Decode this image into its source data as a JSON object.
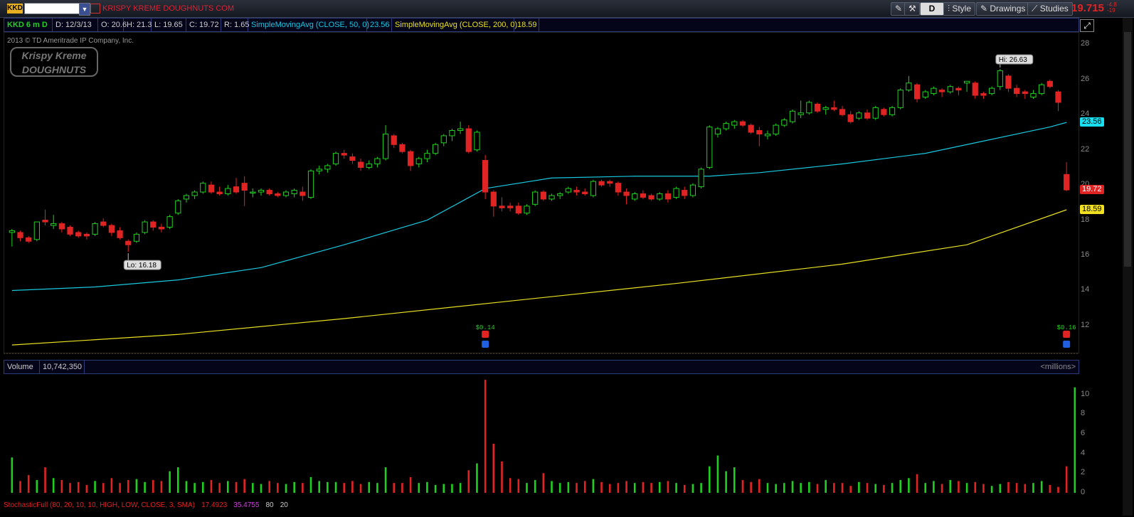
{
  "toolbar": {
    "symbol_badge": "KKD",
    "company_name": "KRISPY KREME DOUGHNUTS COM",
    "period_button": "D",
    "style_label": "Style",
    "drawings_label": "Drawings",
    "studies_label": "Studies",
    "last_price": "19.715",
    "change_top": "-4.8",
    "change_bottom": "-19"
  },
  "studybar": {
    "ticker_period": "KKD 6 m D",
    "date": "D: 12/3/13",
    "open": "O: 20.6",
    "high": "H: 21.3",
    "low": "L: 19.65",
    "close": "C: 19.72",
    "range": "R: 1.65",
    "sma50_label": "SimpleMovingAvg (CLOSE, 50, 0)",
    "sma50_value": "23.56",
    "sma200_label": "SimpleMovingAvg (CLOSE, 200, 0)",
    "sma200_value": "18.59"
  },
  "copyright": "2013 © TD Ameritrade IP Company, Inc.",
  "logo_text": "Krispy Kreme DOUGHNUTS",
  "price_panel": {
    "hi_label": "Hi: 26.63",
    "lo_label": "Lo: 16.18",
    "dividend_1": "$0.14",
    "dividend_2": "$0.16",
    "axis_ticks": [
      "28",
      "26",
      "24",
      "22",
      "20",
      "18",
      "16",
      "14",
      "12"
    ],
    "tag_sma50": "23.56",
    "tag_close": "19.72",
    "tag_sma200": "18.59"
  },
  "volume_panel": {
    "label": "Volume",
    "value": "10,742,350",
    "unit": "<millions>",
    "axis_ticks": [
      "10",
      "8",
      "6",
      "4",
      "2",
      "0"
    ]
  },
  "stoch_panel": {
    "label": "StochasticFull (80, 20, 10, 10, HIGH, LOW, CLOSE, 3, SMA)",
    "k": "17.4923",
    "d": "35.4755",
    "ob": "80",
    "os": "20"
  },
  "chart_data": {
    "type": "candlestick",
    "title": "KKD 6 m D",
    "ylim": [
      10.5,
      28.5
    ],
    "candles": [
      [
        17.3,
        17.5,
        16.5,
        17.4
      ],
      [
        17.3,
        17.4,
        16.8,
        17.0
      ],
      [
        17.0,
        17.1,
        16.7,
        16.8
      ],
      [
        16.9,
        17.9,
        16.8,
        17.9
      ],
      [
        18.0,
        18.6,
        17.7,
        17.9
      ],
      [
        17.7,
        18.3,
        17.5,
        17.8
      ],
      [
        17.8,
        17.9,
        17.3,
        17.5
      ],
      [
        17.6,
        17.7,
        17.1,
        17.2
      ],
      [
        17.3,
        17.4,
        17.0,
        17.1
      ],
      [
        17.2,
        17.3,
        16.9,
        17.1
      ],
      [
        17.2,
        17.9,
        17.1,
        17.8
      ],
      [
        17.9,
        18.1,
        17.6,
        17.7
      ],
      [
        17.7,
        17.8,
        17.1,
        17.3
      ],
      [
        17.4,
        17.6,
        16.9,
        17.0
      ],
      [
        16.8,
        16.9,
        16.2,
        16.6
      ],
      [
        16.8,
        17.3,
        16.7,
        17.2
      ],
      [
        17.3,
        18.0,
        17.2,
        17.9
      ],
      [
        17.9,
        18.0,
        17.4,
        17.6
      ],
      [
        17.6,
        17.8,
        17.3,
        17.5
      ],
      [
        17.6,
        18.3,
        17.5,
        18.2
      ],
      [
        18.4,
        19.2,
        18.3,
        19.1
      ],
      [
        19.2,
        19.5,
        19.0,
        19.4
      ],
      [
        19.4,
        19.7,
        19.2,
        19.6
      ],
      [
        19.6,
        20.2,
        19.5,
        20.1
      ],
      [
        20.0,
        20.2,
        19.5,
        19.6
      ],
      [
        19.6,
        19.9,
        19.4,
        19.5
      ],
      [
        19.5,
        20.0,
        19.4,
        19.8
      ],
      [
        19.9,
        20.4,
        19.5,
        19.6
      ],
      [
        20.1,
        20.5,
        18.8,
        19.7
      ],
      [
        19.6,
        19.8,
        19.3,
        19.6
      ],
      [
        19.6,
        19.8,
        19.4,
        19.7
      ],
      [
        19.7,
        19.8,
        19.4,
        19.5
      ],
      [
        19.5,
        19.6,
        19.3,
        19.4
      ],
      [
        19.4,
        19.7,
        19.3,
        19.6
      ],
      [
        19.5,
        19.8,
        19.3,
        19.7
      ],
      [
        19.6,
        19.9,
        19.1,
        19.4
      ],
      [
        19.3,
        20.9,
        19.2,
        20.8
      ],
      [
        20.8,
        21.1,
        20.6,
        20.9
      ],
      [
        20.9,
        21.2,
        20.7,
        21.1
      ],
      [
        21.2,
        21.9,
        21.1,
        21.8
      ],
      [
        21.8,
        22.0,
        21.5,
        21.7
      ],
      [
        21.6,
        21.8,
        21.2,
        21.4
      ],
      [
        21.3,
        21.5,
        20.8,
        21.0
      ],
      [
        21.0,
        21.4,
        20.9,
        21.2
      ],
      [
        21.2,
        21.6,
        21.0,
        21.5
      ],
      [
        21.5,
        23.4,
        21.4,
        22.9
      ],
      [
        22.8,
        22.9,
        22.1,
        22.3
      ],
      [
        22.3,
        22.4,
        21.8,
        21.9
      ],
      [
        21.9,
        22.0,
        20.8,
        21.1
      ],
      [
        21.2,
        21.6,
        21.0,
        21.5
      ],
      [
        21.5,
        22.0,
        21.3,
        21.8
      ],
      [
        21.8,
        22.4,
        21.7,
        22.3
      ],
      [
        22.4,
        22.9,
        22.2,
        22.8
      ],
      [
        22.8,
        23.2,
        22.5,
        23.1
      ],
      [
        23.1,
        23.6,
        22.9,
        23.2
      ],
      [
        23.2,
        23.4,
        21.8,
        21.9
      ],
      [
        22.0,
        23.1,
        21.9,
        23.0
      ],
      [
        21.4,
        21.7,
        19.2,
        19.6
      ],
      [
        19.6,
        19.7,
        18.2,
        18.8
      ],
      [
        18.8,
        19.3,
        18.5,
        18.7
      ],
      [
        18.8,
        19.0,
        18.5,
        18.7
      ],
      [
        18.8,
        19.0,
        18.3,
        18.4
      ],
      [
        18.4,
        18.9,
        18.3,
        18.8
      ],
      [
        18.9,
        19.7,
        18.8,
        19.6
      ],
      [
        19.6,
        19.7,
        19.1,
        19.2
      ],
      [
        19.2,
        19.5,
        19.1,
        19.4
      ],
      [
        19.4,
        19.6,
        19.2,
        19.5
      ],
      [
        19.6,
        19.9,
        19.5,
        19.8
      ],
      [
        19.7,
        19.9,
        19.4,
        19.6
      ],
      [
        19.6,
        19.8,
        19.4,
        19.5
      ],
      [
        19.4,
        20.3,
        19.3,
        20.2
      ],
      [
        20.2,
        20.3,
        19.9,
        20.0
      ],
      [
        20.2,
        20.3,
        19.9,
        20.1
      ],
      [
        20.1,
        20.2,
        19.4,
        19.6
      ],
      [
        19.6,
        19.8,
        18.9,
        19.4
      ],
      [
        19.2,
        19.6,
        19.1,
        19.5
      ],
      [
        19.5,
        19.7,
        19.2,
        19.3
      ],
      [
        19.4,
        19.5,
        19.1,
        19.2
      ],
      [
        19.2,
        19.6,
        19.1,
        19.5
      ],
      [
        19.5,
        19.7,
        19.0,
        19.2
      ],
      [
        19.3,
        19.9,
        19.2,
        19.8
      ],
      [
        19.7,
        19.9,
        19.2,
        19.4
      ],
      [
        19.4,
        20.1,
        19.3,
        20.0
      ],
      [
        19.9,
        21.0,
        19.8,
        20.9
      ],
      [
        21.0,
        23.4,
        20.9,
        23.3
      ],
      [
        22.9,
        23.3,
        22.7,
        23.2
      ],
      [
        23.2,
        23.6,
        23.1,
        23.5
      ],
      [
        23.4,
        23.7,
        23.2,
        23.6
      ],
      [
        23.6,
        23.7,
        23.3,
        23.4
      ],
      [
        23.4,
        23.5,
        22.9,
        23.0
      ],
      [
        23.1,
        23.3,
        22.2,
        22.9
      ],
      [
        22.8,
        23.1,
        22.6,
        22.9
      ],
      [
        22.9,
        23.5,
        22.8,
        23.4
      ],
      [
        23.4,
        23.8,
        23.3,
        23.7
      ],
      [
        23.6,
        24.3,
        23.5,
        24.2
      ],
      [
        24.0,
        24.8,
        23.8,
        24.1
      ],
      [
        24.1,
        24.8,
        24.0,
        24.7
      ],
      [
        24.6,
        24.7,
        24.1,
        24.2
      ],
      [
        24.3,
        24.5,
        24.0,
        24.4
      ],
      [
        24.4,
        24.8,
        24.2,
        24.3
      ],
      [
        24.3,
        24.5,
        23.9,
        24.0
      ],
      [
        24.0,
        24.2,
        23.5,
        23.6
      ],
      [
        23.8,
        24.2,
        23.7,
        24.1
      ],
      [
        24.1,
        24.3,
        23.7,
        23.8
      ],
      [
        23.8,
        24.5,
        23.7,
        24.4
      ],
      [
        24.3,
        24.4,
        23.9,
        24.0
      ],
      [
        24.0,
        24.5,
        23.9,
        24.4
      ],
      [
        24.4,
        25.5,
        24.3,
        25.4
      ],
      [
        25.4,
        26.2,
        25.3,
        25.8
      ],
      [
        25.7,
        25.8,
        24.7,
        24.9
      ],
      [
        25.0,
        25.4,
        24.9,
        25.3
      ],
      [
        25.2,
        25.6,
        25.1,
        25.5
      ],
      [
        25.4,
        25.5,
        25.0,
        25.3
      ],
      [
        25.3,
        25.7,
        25.2,
        25.6
      ],
      [
        25.5,
        25.6,
        25.1,
        25.4
      ],
      [
        25.8,
        25.9,
        25.3,
        25.9
      ],
      [
        25.8,
        25.9,
        24.9,
        25.1
      ],
      [
        25.2,
        25.3,
        24.9,
        25.1
      ],
      [
        25.2,
        25.6,
        25.1,
        25.5
      ],
      [
        25.6,
        26.6,
        25.4,
        26.5
      ],
      [
        26.2,
        26.3,
        25.3,
        25.5
      ],
      [
        25.5,
        25.7,
        25.0,
        25.2
      ],
      [
        25.3,
        25.4,
        24.9,
        25.2
      ],
      [
        25.0,
        25.4,
        24.9,
        25.2
      ],
      [
        25.2,
        25.8,
        25.1,
        25.7
      ],
      [
        25.9,
        26.0,
        25.5,
        25.6
      ],
      [
        25.3,
        25.4,
        24.2,
        24.7
      ],
      [
        20.6,
        21.3,
        19.65,
        19.72
      ]
    ],
    "sma50": {
      "name": "SimpleMovingAvg (CLOSE, 50, 0)",
      "color": "#18c8e0",
      "start": 14.0,
      "points": [
        [
          0,
          14.0
        ],
        [
          10,
          14.2
        ],
        [
          20,
          14.6
        ],
        [
          30,
          15.3
        ],
        [
          40,
          16.6
        ],
        [
          50,
          18.0
        ],
        [
          57,
          19.8
        ],
        [
          65,
          20.4
        ],
        [
          75,
          20.5
        ],
        [
          84,
          20.5
        ],
        [
          90,
          20.7
        ],
        [
          100,
          21.2
        ],
        [
          110,
          21.8
        ],
        [
          118,
          22.6
        ],
        [
          125,
          23.3
        ],
        [
          127,
          23.56
        ]
      ]
    },
    "sma200": {
      "name": "SimpleMovingAvg (CLOSE, 200, 0)",
      "color": "#e8e020",
      "points": [
        [
          0,
          10.9
        ],
        [
          20,
          11.5
        ],
        [
          40,
          12.4
        ],
        [
          60,
          13.4
        ],
        [
          80,
          14.4
        ],
        [
          100,
          15.5
        ],
        [
          115,
          16.6
        ],
        [
          127,
          18.59
        ]
      ]
    },
    "volume": [
      3.6,
      1.2,
      1.8,
      1.3,
      2.6,
      1.5,
      1.3,
      1.0,
      1.1,
      0.8,
      1.2,
      1.0,
      1.5,
      1.0,
      1.3,
      1.4,
      1.1,
      1.3,
      1.2,
      2.2,
      2.6,
      1.2,
      1.0,
      1.1,
      1.3,
      1.0,
      1.2,
      1.1,
      1.4,
      1.0,
      0.9,
      1.2,
      1.0,
      0.9,
      1.1,
      1.0,
      1.6,
      1.2,
      1.1,
      1.1,
      1.0,
      1.2,
      0.9,
      1.1,
      1.0,
      2.6,
      1.0,
      1.0,
      1.6,
      1.0,
      1.1,
      0.8,
      0.9,
      0.9,
      1.0,
      2.3,
      3.0,
      11.5,
      5.0,
      3.2,
      1.5,
      1.4,
      1.0,
      1.3,
      2.0,
      1.2,
      1.0,
      1.1,
      1.0,
      1.2,
      1.4,
      1.1,
      0.9,
      1.0,
      1.2,
      1.0,
      1.1,
      1.0,
      1.1,
      1.2,
      1.0,
      0.8,
      0.9,
      1.0,
      2.7,
      3.8,
      2.2,
      2.6,
      1.3,
      1.1,
      1.4,
      1.0,
      0.9,
      1.0,
      1.2,
      1.0,
      1.1,
      0.9,
      1.3,
      1.0,
      1.0,
      0.7,
      1.1,
      1.0,
      0.9,
      0.8,
      1.0,
      1.3,
      1.5,
      1.9,
      1.0,
      1.2,
      0.9,
      1.3,
      1.2,
      1.0,
      1.1,
      0.9,
      0.7,
      0.9,
      1.1,
      1.0,
      0.9,
      1.0,
      1.2,
      0.8,
      0.6,
      2.7,
      10.74
    ],
    "volume_colors_note_omitted": true
  }
}
